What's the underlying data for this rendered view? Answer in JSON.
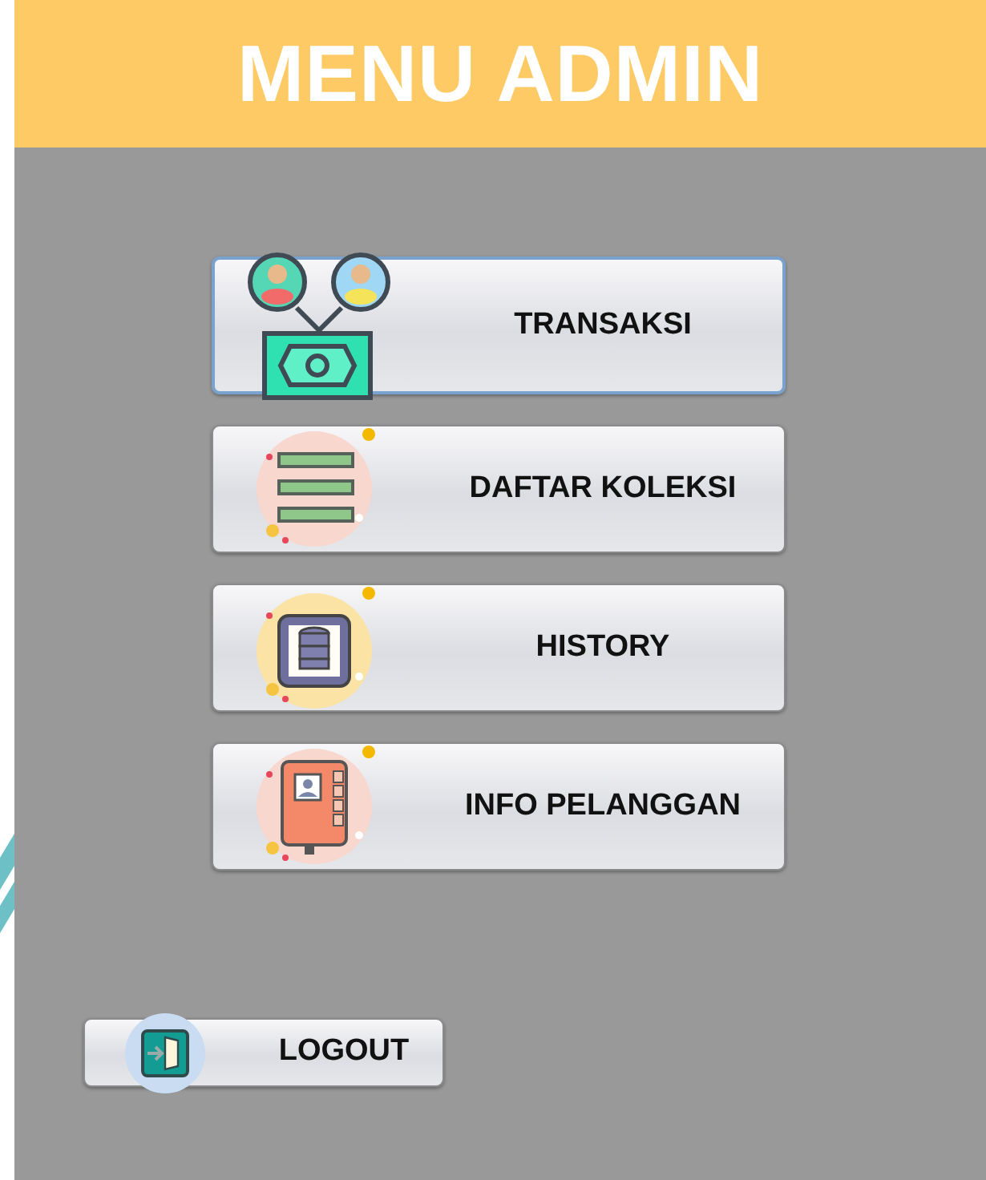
{
  "header": {
    "title": "MENU ADMIN"
  },
  "menu": [
    {
      "label": "TRANSAKSI",
      "focused": true
    },
    {
      "label": "DAFTAR KOLEKSI",
      "focused": false
    },
    {
      "label": "HISTORY",
      "focused": false
    },
    {
      "label": "INFO PELANGGAN",
      "focused": false
    }
  ],
  "logout": {
    "label": "LOGOUT"
  }
}
